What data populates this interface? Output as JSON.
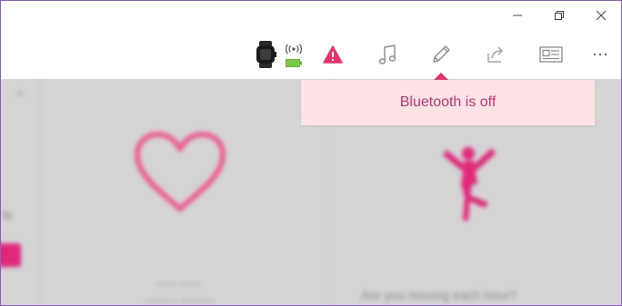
{
  "window": {
    "minimize_icon": "minimize-icon",
    "maximize_icon": "restore-icon",
    "close_icon": "close-icon"
  },
  "toolbar": {
    "device": {
      "icon": "smartwatch-icon",
      "sync_icon": "wireless-sync-icon",
      "battery_icon": "battery-icon",
      "battery_color": "#7dc843"
    },
    "items": [
      {
        "name": "warning",
        "icon": "warning-icon",
        "color": "#e8326e"
      },
      {
        "name": "music",
        "icon": "music-note-icon",
        "color": "#8a8a8a"
      },
      {
        "name": "edit",
        "icon": "pencil-icon",
        "color": "#8a8a8a"
      },
      {
        "name": "share",
        "icon": "share-icon",
        "color": "#a0a0a0"
      },
      {
        "name": "profile",
        "icon": "id-card-icon",
        "color": "#8a8a8a"
      },
      {
        "name": "more",
        "icon": "more-icon",
        "color": "#8a8a8a"
      }
    ]
  },
  "toast": {
    "message": "Bluetooth is off",
    "background": "#fde3e6",
    "text_color": "#c9336e",
    "accent": "#e8326e"
  },
  "content": {
    "left_tile": {
      "icon": "heart-icon",
      "caption_line1": "—— ——",
      "caption_line2": "——— ———"
    },
    "right_tile": {
      "icon": "dancer-icon",
      "caption": "Are you moving each hour?"
    },
    "side_text": "lb",
    "accent": "#e0287a"
  }
}
